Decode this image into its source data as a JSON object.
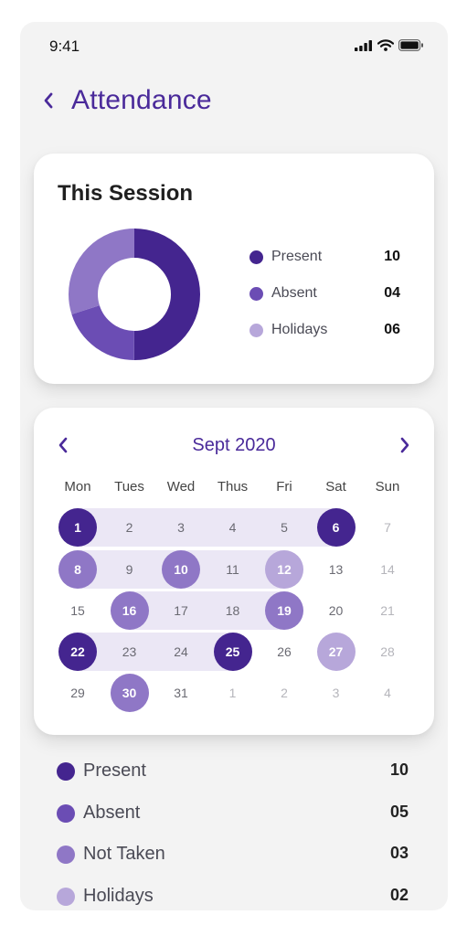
{
  "status_bar": {
    "time": "9:41",
    "icons": [
      "signal-icon",
      "wifi-icon",
      "battery-icon"
    ]
  },
  "header": {
    "back_icon": "chevron-left-icon",
    "title": "Attendance"
  },
  "session": {
    "title": "This Session",
    "legend": [
      {
        "label": "Present",
        "value": "10",
        "color": "#44258f"
      },
      {
        "label": "Absent",
        "value": "04",
        "color": "#6b4db4"
      },
      {
        "label": "Holidays",
        "value": "06",
        "color": "#b7a7da"
      }
    ],
    "donut_colors": [
      "#44258f",
      "#6b4db4",
      "#8f77c6"
    ]
  },
  "calendar": {
    "month": "Sept 2020",
    "prev_icon": "chevron-left-icon",
    "next_icon": "chevron-right-icon",
    "weekdays": [
      "Mon",
      "Tues",
      "Wed",
      "Thus",
      "Fri",
      "Sat",
      "Sun"
    ],
    "weeks": [
      [
        {
          "d": "1",
          "s": "present"
        },
        {
          "d": "2",
          "s": ""
        },
        {
          "d": "3",
          "s": ""
        },
        {
          "d": "4",
          "s": ""
        },
        {
          "d": "5",
          "s": ""
        },
        {
          "d": "6",
          "s": "present"
        },
        {
          "d": "7",
          "s": "other"
        }
      ],
      [
        {
          "d": "8",
          "s": "absent"
        },
        {
          "d": "9",
          "s": ""
        },
        {
          "d": "10",
          "s": "absent"
        },
        {
          "d": "11",
          "s": ""
        },
        {
          "d": "12",
          "s": "holiday"
        },
        {
          "d": "13",
          "s": ""
        },
        {
          "d": "14",
          "s": "other"
        }
      ],
      [
        {
          "d": "15",
          "s": ""
        },
        {
          "d": "16",
          "s": "absent"
        },
        {
          "d": "17",
          "s": ""
        },
        {
          "d": "18",
          "s": ""
        },
        {
          "d": "19",
          "s": "absent"
        },
        {
          "d": "20",
          "s": ""
        },
        {
          "d": "21",
          "s": "other"
        }
      ],
      [
        {
          "d": "22",
          "s": "present"
        },
        {
          "d": "23",
          "s": ""
        },
        {
          "d": "24",
          "s": ""
        },
        {
          "d": "25",
          "s": "present"
        },
        {
          "d": "26",
          "s": ""
        },
        {
          "d": "27",
          "s": "holiday"
        },
        {
          "d": "28",
          "s": "other"
        }
      ],
      [
        {
          "d": "29",
          "s": ""
        },
        {
          "d": "30",
          "s": "absent"
        },
        {
          "d": "31",
          "s": ""
        },
        {
          "d": "1",
          "s": "other"
        },
        {
          "d": "2",
          "s": "other"
        },
        {
          "d": "3",
          "s": "other"
        },
        {
          "d": "4",
          "s": "other"
        }
      ]
    ]
  },
  "summary": [
    {
      "label": "Present",
      "value": "10",
      "color": "#44258f"
    },
    {
      "label": "Absent",
      "value": "05",
      "color": "#6b4db4"
    },
    {
      "label": "Not Taken",
      "value": "03",
      "color": "#8f77c6"
    },
    {
      "label": "Holidays",
      "value": "02",
      "color": "#b7a7da"
    }
  ]
}
